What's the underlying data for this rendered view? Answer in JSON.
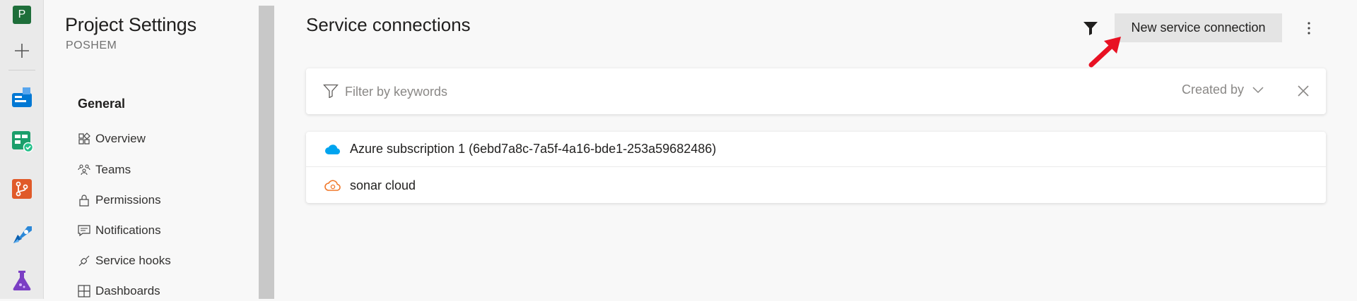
{
  "rail": {
    "project_initial": "P",
    "colors": {
      "project": "#1e6e3a",
      "boards": "#0078d4",
      "repos": "#e05a29",
      "test": "#7b3fc4"
    }
  },
  "nav": {
    "title": "Project Settings",
    "subtitle": "POSHEM",
    "section": "General",
    "items": [
      {
        "label": "Overview",
        "icon": "overview-icon"
      },
      {
        "label": "Teams",
        "icon": "teams-icon"
      },
      {
        "label": "Permissions",
        "icon": "lock-icon"
      },
      {
        "label": "Notifications",
        "icon": "notifications-icon"
      },
      {
        "label": "Service hooks",
        "icon": "service-hooks-icon"
      },
      {
        "label": "Dashboards",
        "icon": "dashboards-icon"
      }
    ]
  },
  "main": {
    "title": "Service connections",
    "new_button": "New service connection",
    "filter": {
      "placeholder": "Filter by keywords",
      "created_by": "Created by"
    },
    "connections": [
      {
        "name": "Azure subscription 1 (6ebd7a8c-7a5f-4a16-bde1-253a59682486)",
        "icon": "azure-cloud-icon",
        "color": "#00a4ef"
      },
      {
        "name": "sonar cloud",
        "icon": "sonarcloud-icon",
        "color": "#f0782a"
      }
    ]
  },
  "annotation": {
    "arrow_color": "#e81123"
  }
}
